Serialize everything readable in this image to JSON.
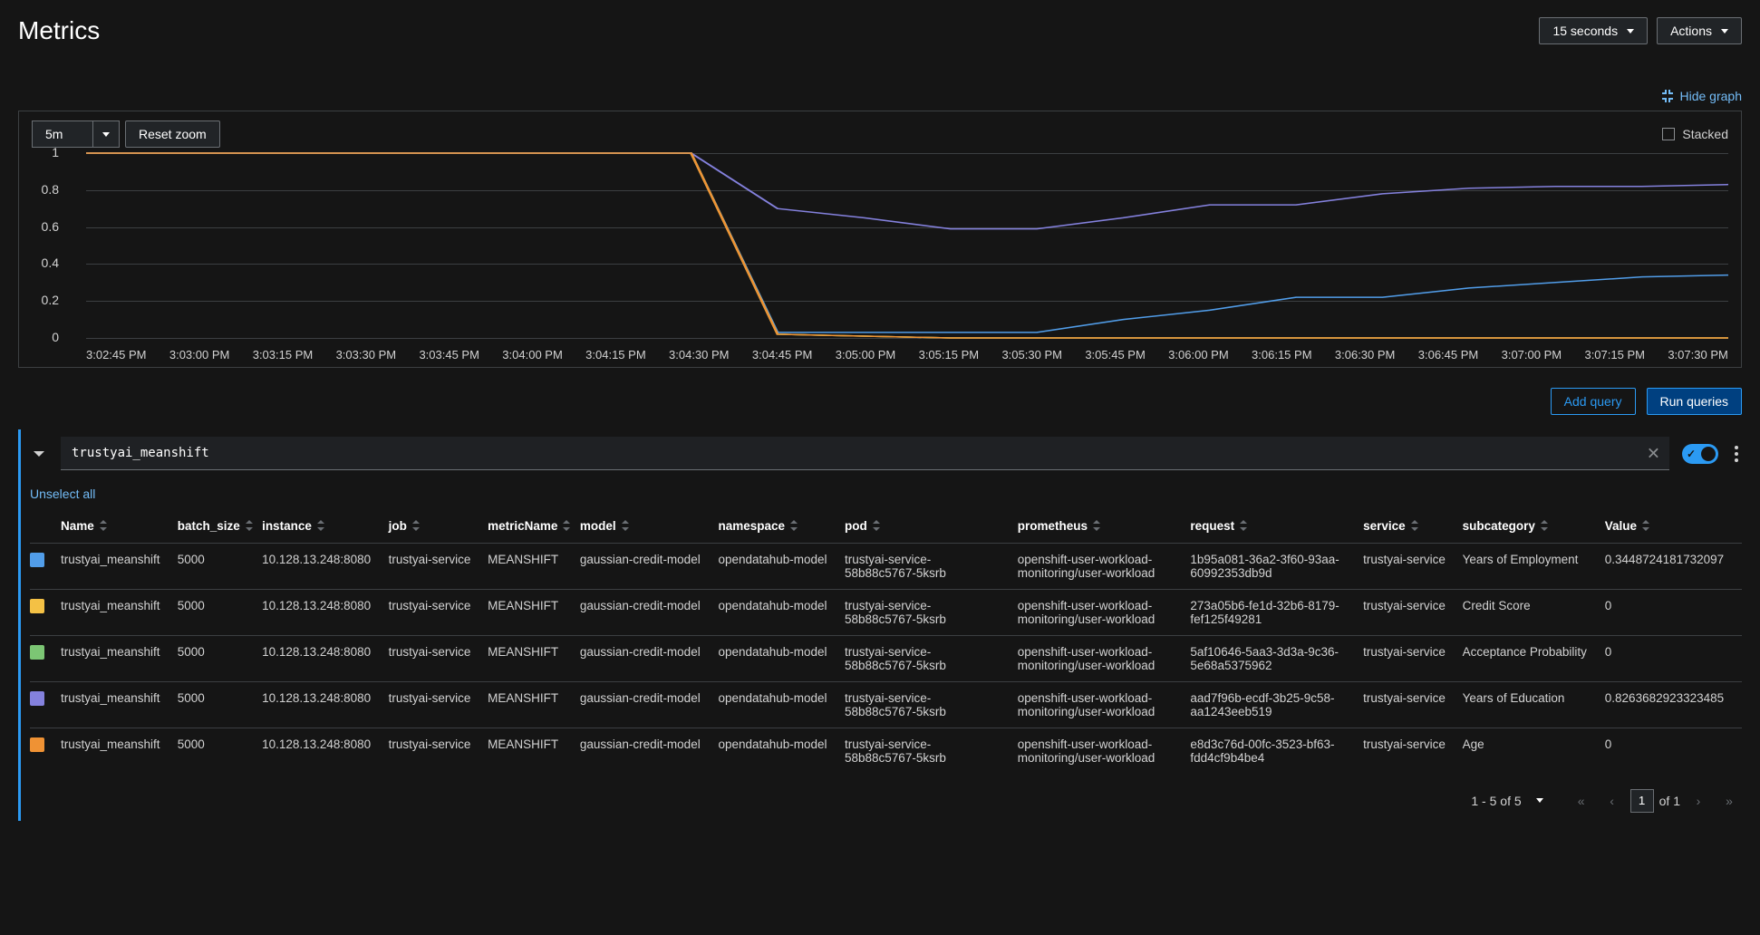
{
  "header": {
    "title": "Metrics",
    "refresh": "15 seconds",
    "actions": "Actions"
  },
  "hide_graph": "Hide graph",
  "graph_toolbar": {
    "range": "5m",
    "reset_zoom": "Reset zoom",
    "stacked_label": "Stacked"
  },
  "chart_data": {
    "type": "line",
    "ylim": [
      0,
      1
    ],
    "y_ticks": [
      0,
      0.2,
      0.4,
      0.6,
      0.8,
      1
    ],
    "x_ticks": [
      "3:02:45 PM",
      "3:03:00 PM",
      "3:03:15 PM",
      "3:03:30 PM",
      "3:03:45 PM",
      "3:04:00 PM",
      "3:04:15 PM",
      "3:04:30 PM",
      "3:04:45 PM",
      "3:05:00 PM",
      "3:05:15 PM",
      "3:05:30 PM",
      "3:05:45 PM",
      "3:06:00 PM",
      "3:06:15 PM",
      "3:06:30 PM",
      "3:06:45 PM",
      "3:07:00 PM",
      "3:07:15 PM",
      "3:07:30 PM"
    ],
    "x": [
      0,
      15,
      30,
      45,
      60,
      75,
      90,
      105,
      120,
      135,
      150,
      165,
      180,
      195,
      210,
      225,
      240,
      255,
      270,
      285
    ],
    "series": [
      {
        "name": "Years of Employment",
        "color": "#519de9",
        "values": [
          1,
          1,
          1,
          1,
          1,
          1,
          1,
          1,
          0.03,
          0.03,
          0.03,
          0.03,
          0.1,
          0.15,
          0.22,
          0.22,
          0.27,
          0.3,
          0.33,
          0.34
        ]
      },
      {
        "name": "Credit Score",
        "color": "#f4c145",
        "values": [
          1,
          1,
          1,
          1,
          1,
          1,
          1,
          1,
          0.02,
          0.01,
          0.0,
          0.0,
          0.0,
          0.0,
          0.0,
          0.0,
          0.0,
          0.0,
          0.0,
          0.0
        ]
      },
      {
        "name": "Acceptance Probability",
        "color": "#7cc674",
        "values": [
          1,
          1,
          1,
          1,
          1,
          1,
          1,
          1,
          0.02,
          0.01,
          0.0,
          0.0,
          0.0,
          0.0,
          0.0,
          0.0,
          0.0,
          0.0,
          0.0,
          0.0
        ]
      },
      {
        "name": "Years of Education",
        "color": "#8481dd",
        "values": [
          1,
          1,
          1,
          1,
          1,
          1,
          1,
          1,
          0.7,
          0.65,
          0.59,
          0.59,
          0.65,
          0.72,
          0.72,
          0.78,
          0.81,
          0.82,
          0.82,
          0.83
        ]
      },
      {
        "name": "Age",
        "color": "#ef9234",
        "values": [
          1,
          1,
          1,
          1,
          1,
          1,
          1,
          1,
          0.02,
          0.01,
          0.0,
          0.0,
          0.0,
          0.0,
          0.0,
          0.0,
          0.0,
          0.0,
          0.0,
          0.0
        ]
      }
    ]
  },
  "query_actions": {
    "add": "Add query",
    "run": "Run queries"
  },
  "query_input": "trustyai_meanshift",
  "unselect_all": "Unselect all",
  "table": {
    "columns": [
      "Name",
      "batch_size",
      "instance",
      "job",
      "metricName",
      "model",
      "namespace",
      "pod",
      "prometheus",
      "request",
      "service",
      "subcategory",
      "Value"
    ],
    "rows": [
      {
        "color": "#519de9",
        "Name": "trustyai_meanshift",
        "batch_size": "5000",
        "instance": "10.128.13.248:8080",
        "job": "trustyai-service",
        "metricName": "MEANSHIFT",
        "model": "gaussian-credit-model",
        "namespace": "opendatahub-model",
        "pod": "trustyai-service-58b88c5767-5ksrb",
        "prometheus": "openshift-user-workload-monitoring/user-workload",
        "request": "1b95a081-36a2-3f60-93aa-60992353db9d",
        "service": "trustyai-service",
        "subcategory": "Years of Employment",
        "Value": "0.3448724181732097"
      },
      {
        "color": "#f4c145",
        "Name": "trustyai_meanshift",
        "batch_size": "5000",
        "instance": "10.128.13.248:8080",
        "job": "trustyai-service",
        "metricName": "MEANSHIFT",
        "model": "gaussian-credit-model",
        "namespace": "opendatahub-model",
        "pod": "trustyai-service-58b88c5767-5ksrb",
        "prometheus": "openshift-user-workload-monitoring/user-workload",
        "request": "273a05b6-fe1d-32b6-8179-fef125f49281",
        "service": "trustyai-service",
        "subcategory": "Credit Score",
        "Value": "0"
      },
      {
        "color": "#7cc674",
        "Name": "trustyai_meanshift",
        "batch_size": "5000",
        "instance": "10.128.13.248:8080",
        "job": "trustyai-service",
        "metricName": "MEANSHIFT",
        "model": "gaussian-credit-model",
        "namespace": "opendatahub-model",
        "pod": "trustyai-service-58b88c5767-5ksrb",
        "prometheus": "openshift-user-workload-monitoring/user-workload",
        "request": "5af10646-5aa3-3d3a-9c36-5e68a5375962",
        "service": "trustyai-service",
        "subcategory": "Acceptance Probability",
        "Value": "0"
      },
      {
        "color": "#8481dd",
        "Name": "trustyai_meanshift",
        "batch_size": "5000",
        "instance": "10.128.13.248:8080",
        "job": "trustyai-service",
        "metricName": "MEANSHIFT",
        "model": "gaussian-credit-model",
        "namespace": "opendatahub-model",
        "pod": "trustyai-service-58b88c5767-5ksrb",
        "prometheus": "openshift-user-workload-monitoring/user-workload",
        "request": "aad7f96b-ecdf-3b25-9c58-aa1243eeb519",
        "service": "trustyai-service",
        "subcategory": "Years of Education",
        "Value": "0.8263682923323485"
      },
      {
        "color": "#ef9234",
        "Name": "trustyai_meanshift",
        "batch_size": "5000",
        "instance": "10.128.13.248:8080",
        "job": "trustyai-service",
        "metricName": "MEANSHIFT",
        "model": "gaussian-credit-model",
        "namespace": "opendatahub-model",
        "pod": "trustyai-service-58b88c5767-5ksrb",
        "prometheus": "openshift-user-workload-monitoring/user-workload",
        "request": "e8d3c76d-00fc-3523-bf63-fdd4cf9b4be4",
        "service": "trustyai-service",
        "subcategory": "Age",
        "Value": "0"
      }
    ]
  },
  "pagination": {
    "summary": "1 - 5 of 5",
    "page": "1",
    "of_label": "of 1"
  }
}
